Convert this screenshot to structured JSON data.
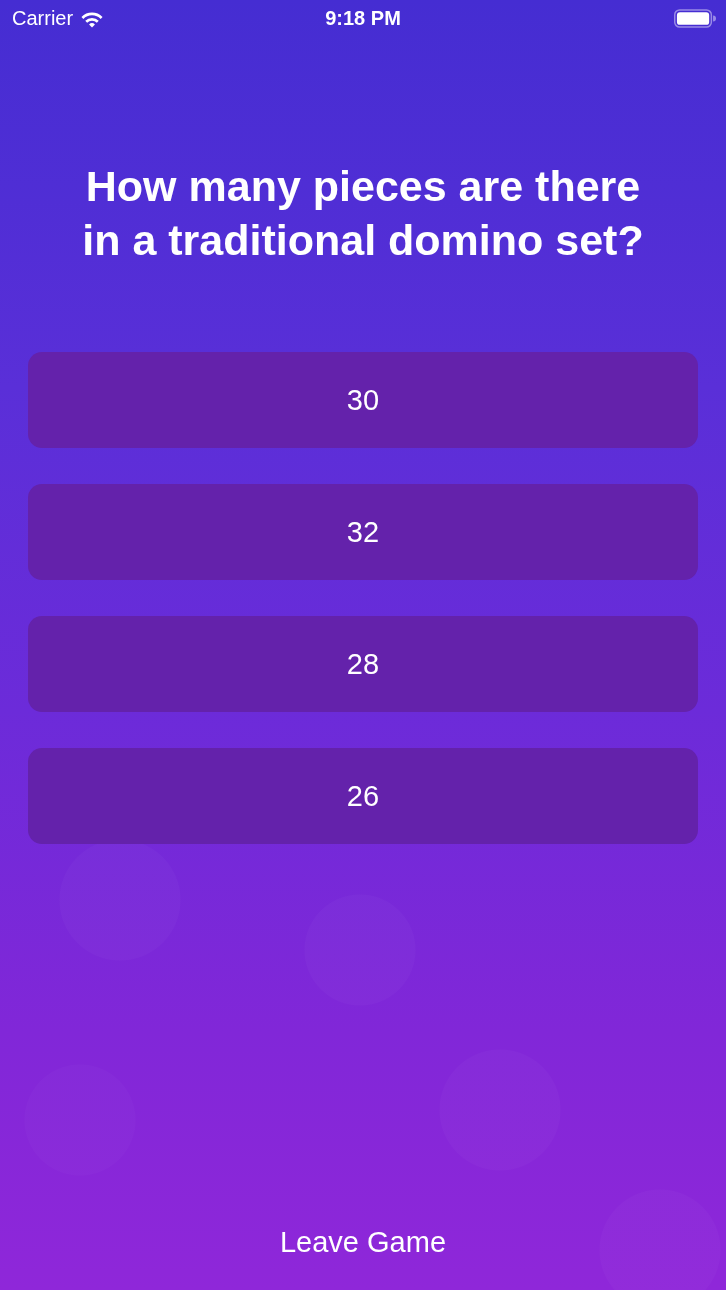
{
  "status_bar": {
    "carrier": "Carrier",
    "time": "9:18 PM"
  },
  "question": "How many pieces are there in a traditional domino set?",
  "answers": [
    "30",
    "32",
    "28",
    "26"
  ],
  "leave_button": "Leave Game"
}
